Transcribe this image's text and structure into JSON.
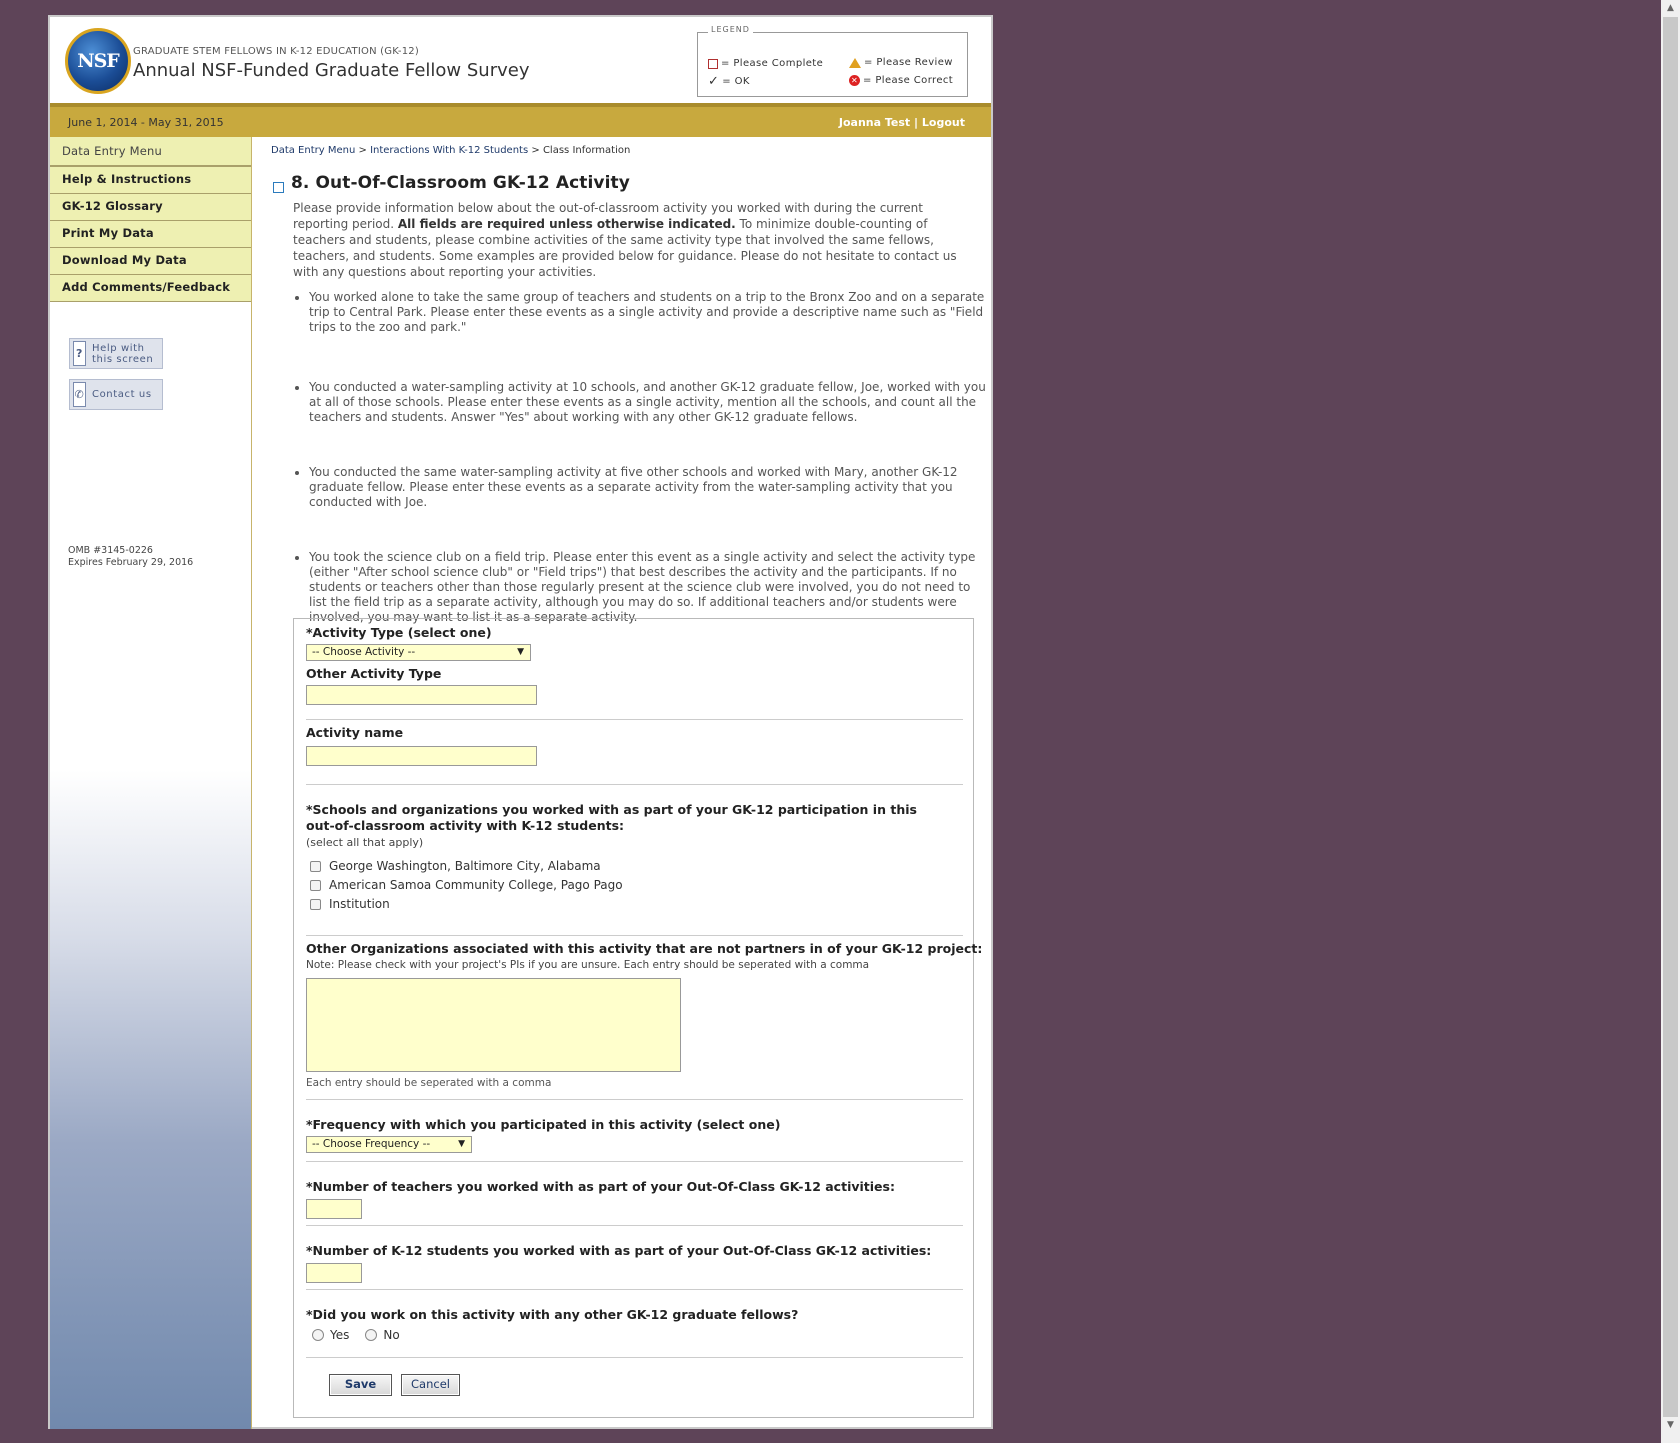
{
  "header": {
    "logo_text": "NSF",
    "program": "GRADUATE STEM FELLOWS IN K-12 EDUCATION (GK-12)",
    "title": "Annual NSF-Funded Graduate Fellow Survey",
    "legend": {
      "label": "LEGEND",
      "please_complete": "= Please Complete",
      "ok": "= OK",
      "please_review": "= Please Review",
      "please_correct": "= Please Correct"
    }
  },
  "bar": {
    "period": "June 1, 2014 - May 31, 2015",
    "user": "Joanna Test",
    "separator": "|",
    "logout": "Logout"
  },
  "sidebar": {
    "menu": [
      "Data Entry Menu",
      "Help & Instructions",
      "GK-12 Glossary",
      "Print My Data",
      "Download My Data",
      "Add Comments/Feedback"
    ],
    "help_button": "Help with this screen",
    "contact_button": "Contact us",
    "omb": "OMB #3145-0226",
    "expires": "Expires February 29, 2016"
  },
  "breadcrumb": {
    "items": [
      "Data Entry Menu",
      "Interactions With K-12 Students",
      "Class Information"
    ],
    "sep": ">"
  },
  "main": {
    "heading": "8. Out-Of-Classroom GK-12 Activity",
    "intro_start": "Please provide information below about the out-of-classroom activity you worked with during the current reporting period. ",
    "intro_bold": "All fields are required unless otherwise indicated.",
    "intro_end": " To minimize double-counting of teachers and students, please combine activities of the same activity type that involved the same fellows, teachers, and students. Some examples are provided below for guidance. Please do not hesitate to contact us with any questions about reporting your activities.",
    "examples": [
      "You worked alone to take the same group of teachers and students on a trip to the Bronx Zoo and on a separate trip to Central Park. Please enter these events as a single activity and provide a descriptive name such as \"Field trips to the zoo and park.\"",
      "You conducted a water-sampling activity at 10 schools, and another GK-12 graduate fellow, Joe, worked with you at all of those schools. Please enter these events as a single activity, mention all the schools, and count all the teachers and students. Answer \"Yes\" about working with any other GK-12 graduate fellows.",
      "You conducted the same water-sampling activity at five other schools and worked with Mary, another GK-12 graduate fellow. Please enter these events as a separate activity from the water-sampling activity that you conducted with Joe.",
      "You took the science club on a field trip. Please enter this event as a single activity and select the activity type (either \"After school science club\" or \"Field trips\") that best describes the activity and the participants. If no students or teachers other than those regularly present at the science club were involved, you do not need to list the field trip as a separate activity, although you may do so. If additional teachers and/or students were involved, you may want to list it as a separate activity."
    ]
  },
  "form": {
    "activity_type_label": "*Activity Type (select one)",
    "activity_type_value": "-- Choose Activity --",
    "other_activity_label": "Other Activity Type",
    "other_activity_value": "",
    "activity_name_label": "Activity name",
    "activity_name_value": "",
    "schools_label_1": "*Schools and organizations you worked with as part of your GK-12 participation in this",
    "schools_label_2": "out-of-classroom activity with K-12 students:",
    "schools_hint": "(select all that apply)",
    "schools": [
      "George Washington, Baltimore City, Alabama",
      "American Samoa Community College, Pago Pago",
      "Institution"
    ],
    "other_orgs_label": "Other Organizations associated with this activity that are not partners in of your GK-12 project:",
    "other_orgs_note": "Note: Please check with your project's PIs if you are unsure. Each entry should be seperated with a comma",
    "other_orgs_value": "",
    "other_orgs_help": "Each entry should be seperated with a comma",
    "frequency_label": "*Frequency with which you participated in this activity (select one)",
    "frequency_value": "-- Choose Frequency --",
    "teachers_label": "*Number of teachers you worked with as part of your Out-Of-Class GK-12 activities:",
    "teachers_value": "",
    "students_label": "*Number of K-12 students you worked with as part of your Out-Of-Class GK-12 activities:",
    "students_value": "",
    "fellows_label": "*Did you work on this activity with any other GK-12 graduate fellows?",
    "yes_label": "Yes",
    "no_label": "No",
    "save_label": "Save",
    "cancel_label": "Cancel"
  },
  "colors": {
    "background": "#5e4458",
    "gold_bar": "#c8a93e",
    "menu_item": "#eef0b2",
    "input_fill": "#ffffcc"
  }
}
